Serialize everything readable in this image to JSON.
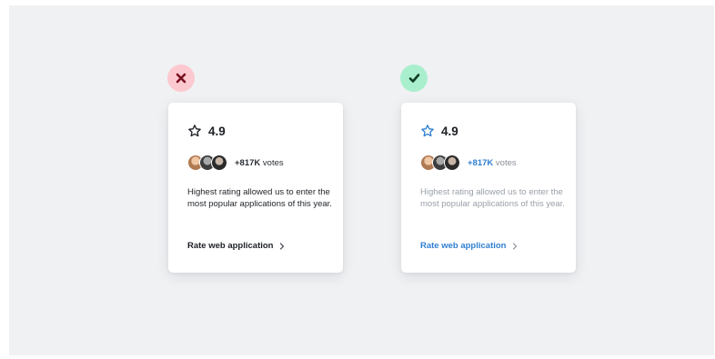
{
  "bad_example": {
    "badge_icon": "close-icon",
    "rating": "4.9",
    "star_icon": "star-outline-icon",
    "votes_count": "+817K",
    "votes_label": "votes",
    "description": "Highest rating allowed us to enter the most popular applications of this year.",
    "cta_label": "Rate web application",
    "cta_icon": "chevron-right-icon",
    "colors": {
      "badge_bg": "#fbc9cf",
      "badge_icon": "#7a1020",
      "text": "#1c1f24"
    }
  },
  "good_example": {
    "badge_icon": "check-icon",
    "rating": "4.9",
    "star_icon": "star-outline-icon",
    "votes_count": "+817K",
    "votes_label": "votes",
    "description": "Highest rating allowed us to enter the most popular applications of this year.",
    "cta_label": "Rate web application",
    "cta_icon": "chevron-right-icon",
    "colors": {
      "badge_bg": "#a9efce",
      "badge_icon": "#0e3d24",
      "accent": "#2f7fd0",
      "muted": "#9aa0a8"
    }
  }
}
